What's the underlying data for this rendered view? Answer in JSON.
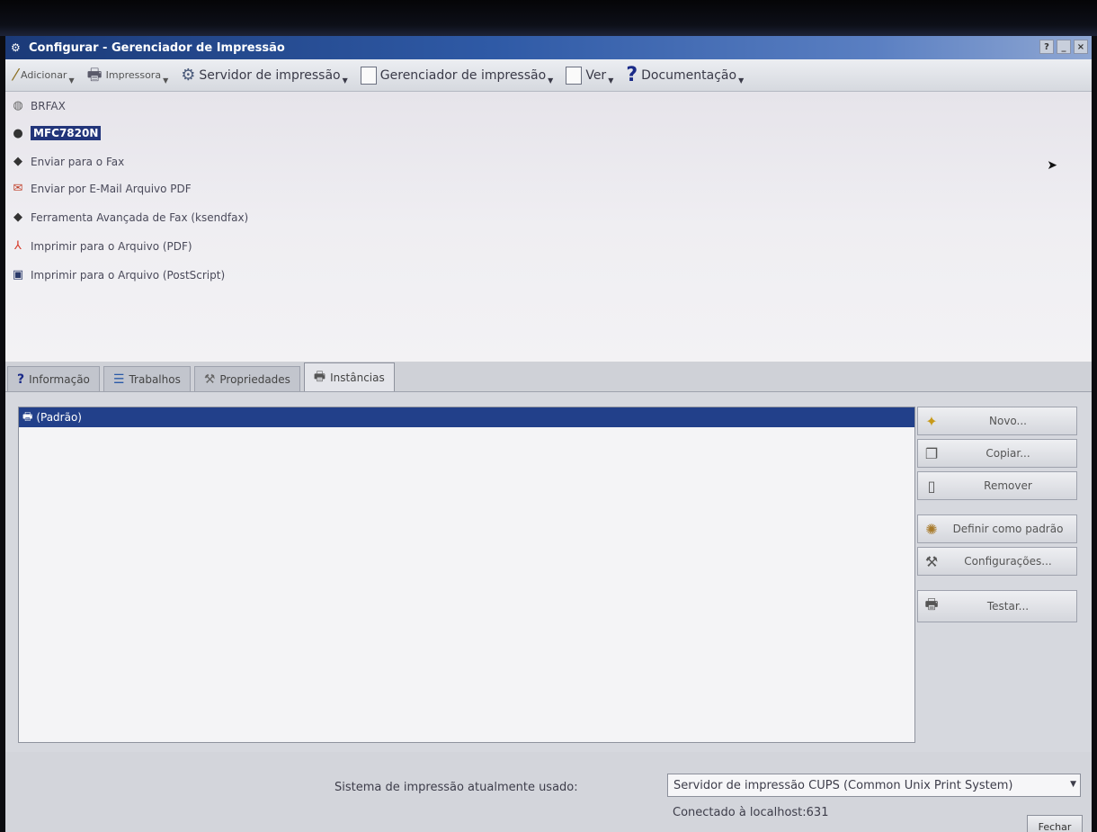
{
  "window": {
    "title": "Configurar - Gerenciador de Impressão"
  },
  "toolbar": {
    "items": [
      {
        "label": "Adicionar",
        "icon": "wand-icon"
      },
      {
        "label": "Impressora",
        "icon": "printer-icon"
      },
      {
        "label": "Servidor de impressão",
        "icon": "server-icon"
      },
      {
        "label": "Gerenciador de impressão",
        "icon": "window-icon"
      },
      {
        "label": "Ver",
        "icon": "view-icon"
      },
      {
        "label": "Documentação",
        "icon": "help-icon"
      }
    ]
  },
  "printers": [
    {
      "label": "BRFAX",
      "icon": "printer-icon",
      "selected": false
    },
    {
      "label": "MFC7820N",
      "icon": "printer-icon",
      "selected": true
    },
    {
      "label": "Enviar para o Fax",
      "icon": "fax-icon",
      "selected": false
    },
    {
      "label": "Enviar por E-Mail Arquivo PDF",
      "icon": "mail-icon",
      "selected": false
    },
    {
      "label": "Ferramenta Avançada de Fax (ksendfax)",
      "icon": "fax-icon",
      "selected": false
    },
    {
      "label": "Imprimir para o Arquivo (PDF)",
      "icon": "pdf-icon",
      "selected": false
    },
    {
      "label": "Imprimir para o Arquivo (PostScript)",
      "icon": "save-icon",
      "selected": false
    }
  ],
  "tabs": [
    {
      "label": "Informação",
      "icon": "help-icon",
      "active": false
    },
    {
      "label": "Trabalhos",
      "icon": "jobs-icon",
      "active": false
    },
    {
      "label": "Propriedades",
      "icon": "properties-icon",
      "active": false
    },
    {
      "label": "Instâncias",
      "icon": "printer-icon",
      "active": true
    }
  ],
  "instances": {
    "rows": [
      "(Padrão)"
    ]
  },
  "side_buttons": [
    {
      "label": "Novo...",
      "icon": "new-icon"
    },
    {
      "label": "Copiar...",
      "icon": "copy-icon"
    },
    {
      "label": "Remover",
      "icon": "trash-icon"
    },
    {
      "label": "Definir como padrão",
      "icon": "default-icon"
    },
    {
      "label": "Configurações...",
      "icon": "settings-icon"
    },
    {
      "label": "Testar...",
      "icon": "printer-icon"
    }
  ],
  "footer": {
    "system_label": "Sistema de impressão atualmente usado:",
    "system_value": "Servidor de impressão CUPS (Common Unix Print System)",
    "connected": "Conectado à localhost:631",
    "close_label": "Fechar"
  }
}
